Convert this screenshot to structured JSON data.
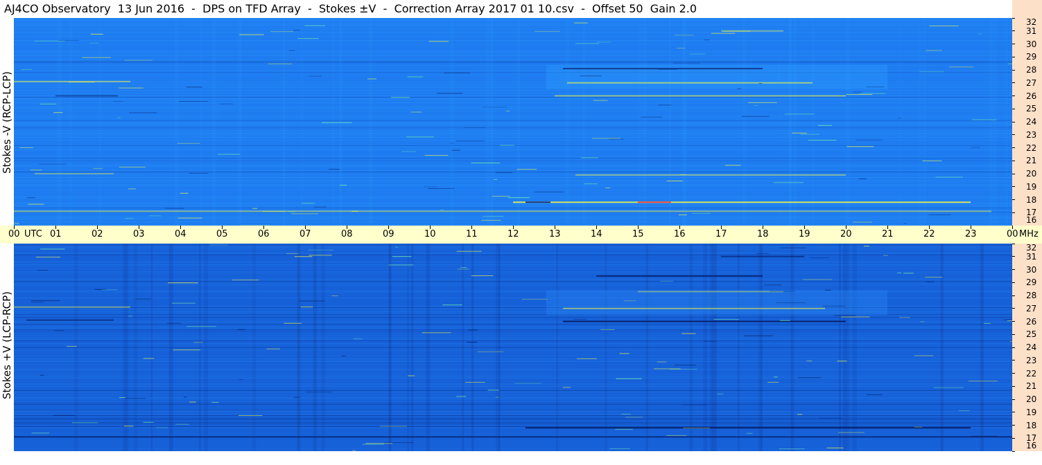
{
  "title": "AJ4CO Observatory  13 Jun 2016  -  DPS on TFD Array  -  Stokes ±V  -  Correction Array 2017 01 10.csv  -  Offset 50  Gain 2.0",
  "chart_data": [
    {
      "type": "heatmap",
      "ylabel": "Stokes -V (RCP-LCP)",
      "x_ticks": [
        "00",
        "01",
        "02",
        "03",
        "04",
        "05",
        "06",
        "07",
        "08",
        "09",
        "10",
        "11",
        "12",
        "13",
        "14",
        "15",
        "16",
        "17",
        "18",
        "19",
        "20",
        "21",
        "22",
        "23",
        "00"
      ],
      "x_unit": "UTC",
      "y_ticks": [
        16,
        17,
        18,
        19,
        20,
        21,
        22,
        23,
        24,
        25,
        26,
        27,
        28,
        29,
        30,
        31,
        32
      ],
      "y_unit": "MHz",
      "xlim": [
        0,
        24
      ],
      "ylim": [
        16,
        32
      ],
      "colors": {
        "base": "#1e7cf0",
        "light": "#2fa0ff",
        "dark": "#0a2b80",
        "yellow": "#ffff40",
        "red": "#ff3030",
        "green": "#7fffa0"
      }
    },
    {
      "type": "heatmap",
      "ylabel": "Stokes +V (LCP-RCP)",
      "x_ticks": [
        "00",
        "01",
        "02",
        "03",
        "04",
        "05",
        "06",
        "07",
        "08",
        "09",
        "10",
        "11",
        "12",
        "13",
        "14",
        "15",
        "16",
        "17",
        "18",
        "19",
        "20",
        "21",
        "22",
        "23",
        "00"
      ],
      "x_unit": "UTC",
      "y_ticks": [
        16,
        17,
        18,
        19,
        20,
        21,
        22,
        23,
        24,
        25,
        26,
        27,
        28,
        29,
        30,
        31,
        32
      ],
      "y_unit": "MHz",
      "xlim": [
        0,
        24
      ],
      "ylim": [
        16,
        32
      ],
      "colors": {
        "base": "#1660d8",
        "light": "#2a8af5",
        "dark": "#051a60",
        "yellow": "#ffff40",
        "red": "#ff3030",
        "green": "#7fffa0"
      }
    }
  ]
}
